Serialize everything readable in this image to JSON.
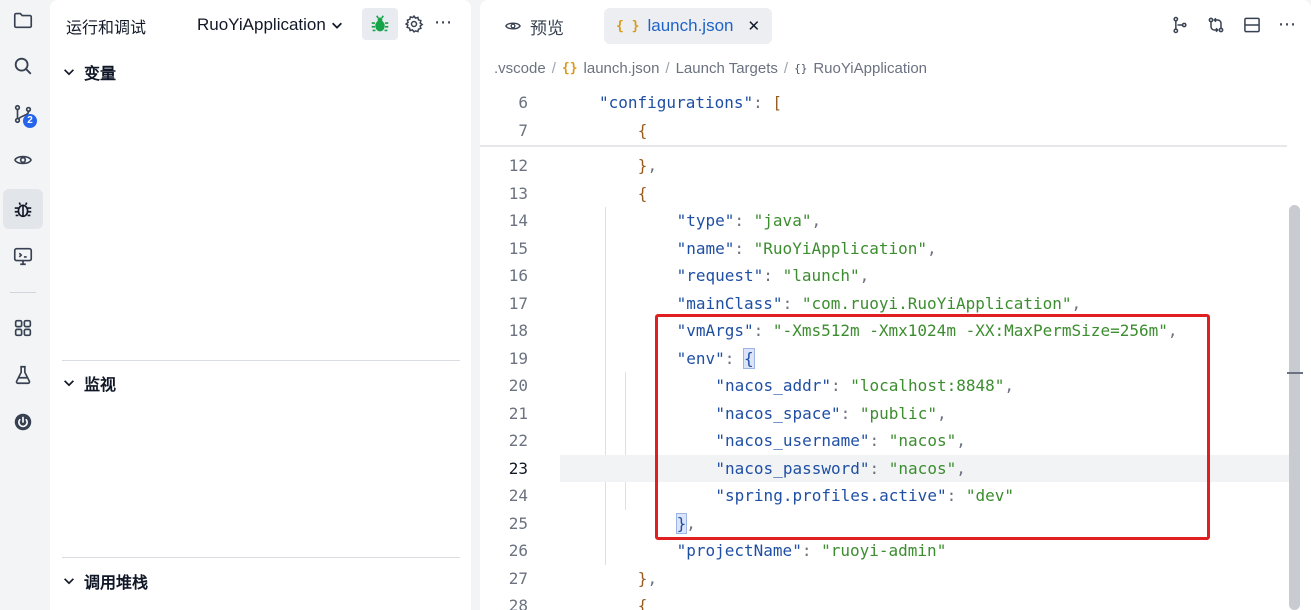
{
  "activity_bar": {
    "items": [
      "explorer-icon",
      "search-icon",
      "source-control-icon",
      "remote-explorer-icon",
      "run-debug-icon",
      "remote-display-icon",
      "extensions-icon",
      "testing-icon",
      "springboot-icon"
    ],
    "source_control_badge": "2",
    "active": "run-debug-icon"
  },
  "sidebar": {
    "title": "运行和调试",
    "config_name": "RuoYiApplication",
    "sections": [
      {
        "label": "变量"
      },
      {
        "label": "监视"
      },
      {
        "label": "调用堆栈"
      }
    ],
    "more": "⋯"
  },
  "tabs": [
    {
      "label": "预览",
      "icon": "preview-eye-icon",
      "active": false
    },
    {
      "label": "launch.json",
      "icon": "json-braces-icon",
      "active": true,
      "close": "✕"
    }
  ],
  "editor_actions": {
    "more": "⋯"
  },
  "breadcrumb": {
    "items": [
      ".vscode",
      "launch.json",
      "Launch Targets",
      "RuoYiApplication"
    ],
    "sep": "/",
    "json_icon": "{}",
    "obj_icon": "{}"
  },
  "code": {
    "current_line": "23",
    "lines": [
      {
        "n": "6",
        "indent": 3,
        "tokens": [
          [
            "k",
            "\"configurations\""
          ],
          [
            "p",
            ": "
          ],
          [
            "br",
            "["
          ]
        ]
      },
      {
        "n": "7",
        "indent": 5,
        "tokens": [
          [
            "br",
            "{"
          ]
        ]
      },
      {
        "n": "12",
        "indent": 5,
        "tokens": [
          [
            "br",
            "}"
          ],
          [
            "p",
            ","
          ]
        ]
      },
      {
        "n": "13",
        "indent": 5,
        "tokens": [
          [
            "br",
            "{"
          ]
        ]
      },
      {
        "n": "14",
        "indent": 7,
        "tokens": [
          [
            "k",
            "\"type\""
          ],
          [
            "p",
            ": "
          ],
          [
            "s",
            "\"java\""
          ],
          [
            "p",
            ","
          ]
        ]
      },
      {
        "n": "15",
        "indent": 7,
        "tokens": [
          [
            "k",
            "\"name\""
          ],
          [
            "p",
            ": "
          ],
          [
            "s",
            "\"RuoYiApplication\""
          ],
          [
            "p",
            ","
          ]
        ]
      },
      {
        "n": "16",
        "indent": 7,
        "tokens": [
          [
            "k",
            "\"request\""
          ],
          [
            "p",
            ": "
          ],
          [
            "s",
            "\"launch\""
          ],
          [
            "p",
            ","
          ]
        ]
      },
      {
        "n": "17",
        "indent": 7,
        "tokens": [
          [
            "k",
            "\"mainClass\""
          ],
          [
            "p",
            ": "
          ],
          [
            "s",
            "\"com.ruoyi.RuoYiApplication\""
          ],
          [
            "p",
            ","
          ]
        ]
      },
      {
        "n": "18",
        "indent": 7,
        "tokens": [
          [
            "k",
            "\"vmArgs\""
          ],
          [
            "p",
            ": "
          ],
          [
            "s",
            "\"-Xms512m -Xmx1024m -XX:MaxPermSize=256m\""
          ],
          [
            "p",
            ","
          ]
        ]
      },
      {
        "n": "19",
        "indent": 7,
        "tokens": [
          [
            "k",
            "\"env\""
          ],
          [
            "p",
            ": "
          ],
          [
            "hl",
            "{"
          ]
        ]
      },
      {
        "n": "20",
        "indent": 9,
        "tokens": [
          [
            "k",
            "\"nacos_addr\""
          ],
          [
            "p",
            ": "
          ],
          [
            "s",
            "\"localhost:8848\""
          ],
          [
            "p",
            ","
          ]
        ]
      },
      {
        "n": "21",
        "indent": 9,
        "tokens": [
          [
            "k",
            "\"nacos_space\""
          ],
          [
            "p",
            ": "
          ],
          [
            "s",
            "\"public\""
          ],
          [
            "p",
            ","
          ]
        ]
      },
      {
        "n": "22",
        "indent": 9,
        "tokens": [
          [
            "k",
            "\"nacos_username\""
          ],
          [
            "p",
            ": "
          ],
          [
            "s",
            "\"nacos\""
          ],
          [
            "p",
            ","
          ]
        ]
      },
      {
        "n": "23",
        "indent": 9,
        "tokens": [
          [
            "k",
            "\"nacos_password\""
          ],
          [
            "p",
            ": "
          ],
          [
            "s",
            "\"nacos\""
          ],
          [
            "p",
            ","
          ]
        ]
      },
      {
        "n": "24",
        "indent": 9,
        "tokens": [
          [
            "k",
            "\"spring.profiles.active\""
          ],
          [
            "p",
            ": "
          ],
          [
            "s",
            "\"dev\""
          ]
        ]
      },
      {
        "n": "25",
        "indent": 7,
        "tokens": [
          [
            "hl",
            "}"
          ],
          [
            "p",
            ","
          ]
        ]
      },
      {
        "n": "26",
        "indent": 7,
        "tokens": [
          [
            "k",
            "\"projectName\""
          ],
          [
            "p",
            ": "
          ],
          [
            "s",
            "\"ruoyi-admin\""
          ]
        ]
      },
      {
        "n": "27",
        "indent": 5,
        "tokens": [
          [
            "br",
            "}"
          ],
          [
            "p",
            ","
          ]
        ]
      },
      {
        "n": "28",
        "indent": 5,
        "tokens": [
          [
            "br",
            "{"
          ]
        ]
      }
    ]
  },
  "colors": {
    "key": "#1f4fa3",
    "string": "#3c8d2f",
    "highlight_box": "#e02020",
    "active_tab_text": "#1e63c8",
    "debug_green": "#16a34a"
  }
}
